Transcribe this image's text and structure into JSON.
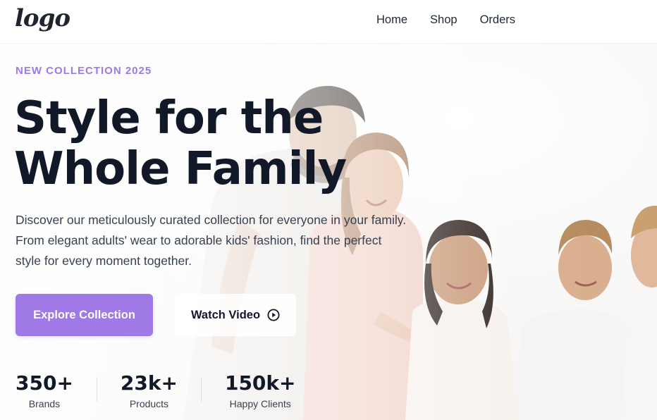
{
  "header": {
    "logo_text": "logo",
    "nav": [
      {
        "label": "Home"
      },
      {
        "label": "Shop"
      },
      {
        "label": "Orders"
      }
    ]
  },
  "hero": {
    "eyebrow": "NEW COLLECTION 2025",
    "title_lines": [
      "Style for the",
      "Whole Family"
    ],
    "description_lines": [
      "Discover our meticulously curated collection for everyone in your family.",
      "From elegant adults' wear to adorable kids' fashion, find the perfect",
      "style for every moment together."
    ],
    "primary_button": "Explore Collection",
    "secondary_button": "Watch Video",
    "secondary_button_icon": "play-circle-icon",
    "background_image": "family-photo"
  },
  "stats": [
    {
      "value": "350+",
      "label": "Brands"
    },
    {
      "value": "23k+",
      "label": "Products"
    },
    {
      "value": "150k+",
      "label": "Happy Clients"
    }
  ],
  "colors": {
    "accent": "#9f7ae6",
    "eyebrow": "#9b7be8",
    "heading": "#111827",
    "body_text": "#374151"
  }
}
